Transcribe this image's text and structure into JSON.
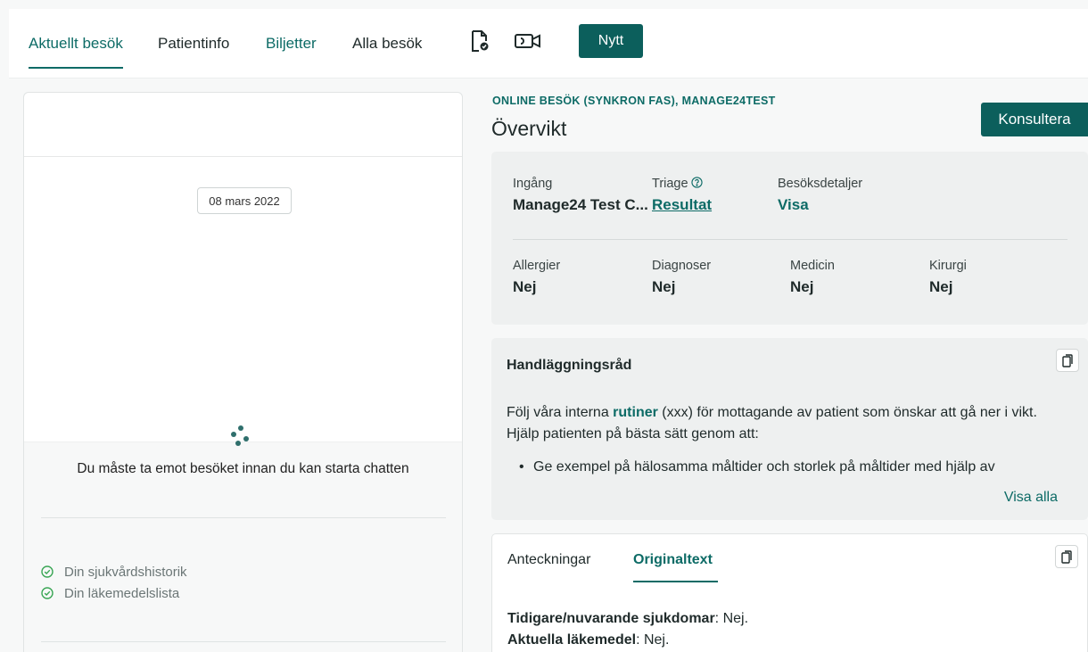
{
  "nav": {
    "tabs": [
      {
        "label": "Aktuellt besök"
      },
      {
        "label": "Patientinfo"
      },
      {
        "label": "Biljetter"
      },
      {
        "label": "Alla besök"
      }
    ],
    "icons": [
      "document-check-icon",
      "video-camera-icon"
    ],
    "new_label": "Nytt"
  },
  "chat": {
    "date": "08 mars 2022",
    "must_accept": "Du måste ta emot besöket innan du kan starta chatten",
    "checklist": [
      {
        "label": "Din sjukvårdshistorik"
      },
      {
        "label": "Din läkemedelslista"
      }
    ]
  },
  "visit": {
    "type": "ONLINE BESÖK (SYNKRON FAS), MANAGE24TEST",
    "title": "Övervikt",
    "consult_label": "Konsultera"
  },
  "info": {
    "row1": [
      {
        "label": "Ingång",
        "value": "Manage24 Test C..."
      },
      {
        "label": "Triage",
        "value": "Resultat"
      },
      {
        "label": "Besöksdetaljer",
        "value": "Visa"
      }
    ],
    "row2": [
      {
        "label": "Allergier",
        "value": "Nej"
      },
      {
        "label": "Diagnoser",
        "value": "Nej"
      },
      {
        "label": "Medicin",
        "value": "Nej"
      },
      {
        "label": "Kirurgi",
        "value": "Nej"
      }
    ]
  },
  "advice": {
    "title": "Handläggningsråd",
    "text_before": "Följ våra interna ",
    "text_link": "rutiner",
    "text_after": " (xxx) för mottagande av patient som önskar att gå ner i vikt. Hjälp patienten på bästa sätt genom att:",
    "bullet": "Ge exempel på hälosamma måltider och storlek på måltider med hjälp av",
    "show_all": "Visa alla"
  },
  "notes": {
    "tabs": [
      {
        "label": "Anteckningar"
      },
      {
        "label": "Originaltext"
      }
    ],
    "lines": [
      {
        "key": "Tidigare/nuvarande sjukdomar",
        "value": ": Nej."
      },
      {
        "key": "Aktuella läkemedel",
        "value": ": Nej."
      }
    ]
  },
  "colors": {
    "primary": "#0c5f5c",
    "link": "#0d6b66",
    "check_green": "#3aa655"
  }
}
